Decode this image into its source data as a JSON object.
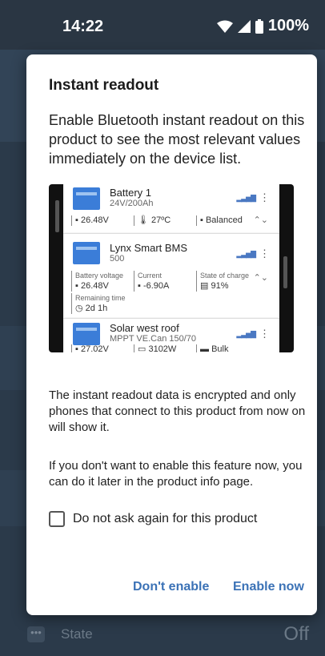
{
  "status_bar": {
    "time": "14:22",
    "battery": "100%"
  },
  "background": {
    "row_label": "State",
    "row_value": "Off",
    "row_icon": "•••"
  },
  "dialog": {
    "title": "Instant readout",
    "intro": "Enable Bluetooth instant readout on this product to see the most relevant values immediately on the device list.",
    "preview": {
      "device1": {
        "name": "Battery 1",
        "sub": "24V/200Ah",
        "m1": "26.48V",
        "m2": "27ºC",
        "m3": "Balanced"
      },
      "device2": {
        "name": "Lynx Smart BMS",
        "sub": "500",
        "l1": "Battery voltage",
        "v1": "26.48V",
        "l2": "Current",
        "v2": "-6.90A",
        "l3": "State of charge",
        "v3": "91%",
        "l4": "Remaining time",
        "v4": "2d 1h"
      },
      "device3": {
        "name": "Solar west roof",
        "sub": "MPPT VE.Can 150/70",
        "m1": "27.02V",
        "m2": "3102W",
        "m3": "Bulk"
      }
    },
    "encrypted_text": "The instant readout data is encrypted and only phones that connect to this product from now on will show it.",
    "later_text": "If you don't want to enable this feature now, you can do it later in the product info page.",
    "checkbox_label": "Do not ask again for this product",
    "cancel_label": "Don't enable",
    "confirm_label": "Enable now"
  },
  "colors": {
    "accent": "#3b72b6",
    "background": "#2b3a4a",
    "dialog": "#ffffff"
  },
  "icons": [
    "wifi-icon",
    "cellular-icon",
    "battery-icon",
    "more-vert-icon",
    "signal-bars-icon",
    "expand-icon",
    "checkbox-icon"
  ]
}
